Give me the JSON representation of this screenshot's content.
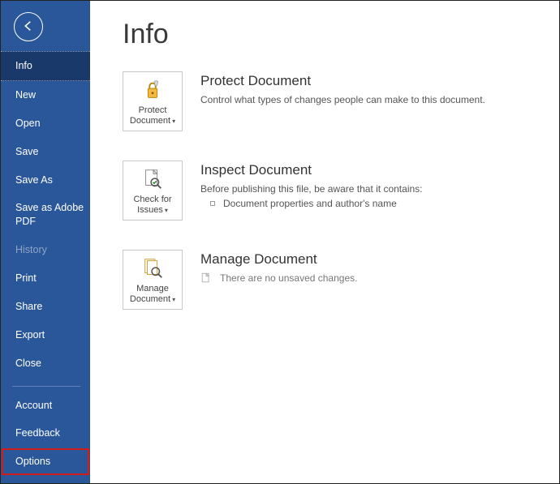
{
  "sidebar": {
    "items": [
      {
        "label": "Info",
        "selected": true
      },
      {
        "label": "New"
      },
      {
        "label": "Open"
      },
      {
        "label": "Save"
      },
      {
        "label": "Save As"
      },
      {
        "label": "Save as Adobe PDF"
      },
      {
        "label": "History",
        "disabled": true
      },
      {
        "label": "Print"
      },
      {
        "label": "Share"
      },
      {
        "label": "Export"
      },
      {
        "label": "Close"
      }
    ],
    "bottom": [
      {
        "label": "Account"
      },
      {
        "label": "Feedback"
      },
      {
        "label": "Options",
        "highlight": true
      }
    ]
  },
  "page": {
    "title": "Info"
  },
  "protect": {
    "tile_label": "Protect Document",
    "heading": "Protect Document",
    "desc": "Control what types of changes people can make to this document."
  },
  "inspect": {
    "tile_label": "Check for Issues",
    "heading": "Inspect Document",
    "desc": "Before publishing this file, be aware that it contains:",
    "bullet": "Document properties and author's name"
  },
  "manage": {
    "tile_label": "Manage Document",
    "heading": "Manage Document",
    "desc": "There are no unsaved changes."
  }
}
